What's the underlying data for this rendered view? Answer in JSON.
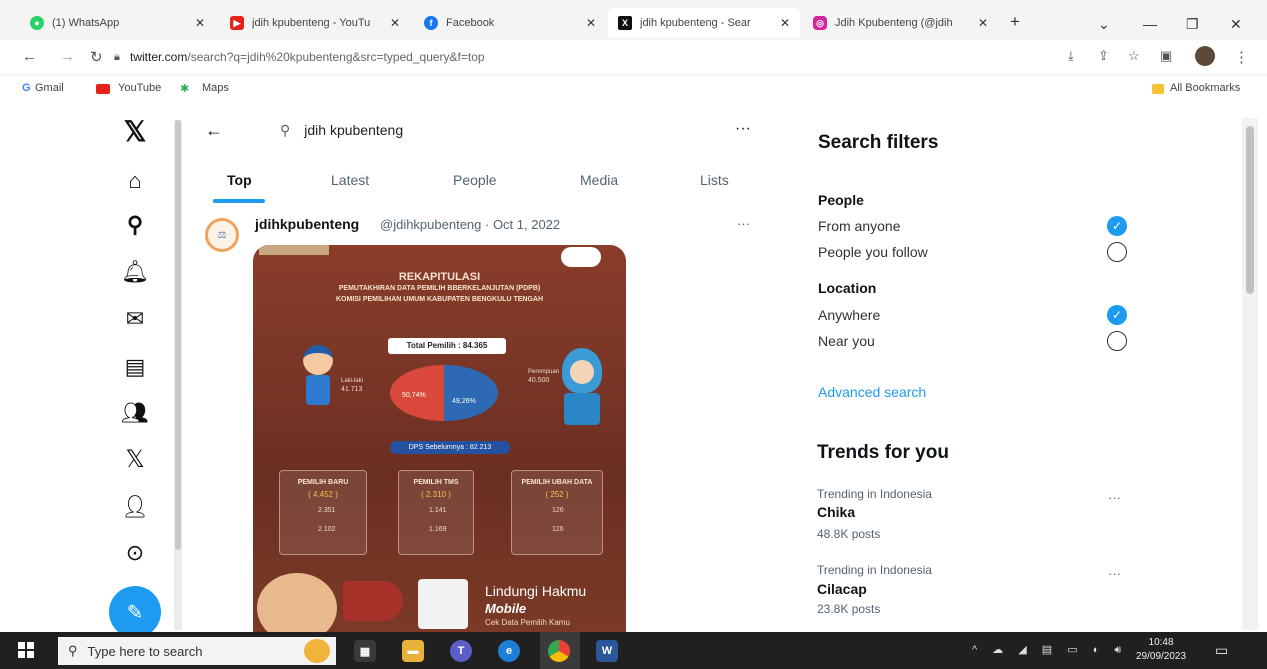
{
  "browser": {
    "tabs": [
      {
        "title": "(1) WhatsApp",
        "color": "#25d366",
        "glyph": "●"
      },
      {
        "title": "jdih kpubenteng - YouTu",
        "color": "#e62117",
        "glyph": "▶"
      },
      {
        "title": "Facebook",
        "color": "#1877f2",
        "glyph": "f"
      },
      {
        "title": "jdih kpubenteng - Sear",
        "color": "#111111",
        "glyph": "X"
      },
      {
        "title": "Jdih Kpubenteng (@jdih",
        "color": "#d6249f",
        "glyph": "◎"
      }
    ],
    "new_tab": "+",
    "url_domain": "twitter.com",
    "url_path": "/search?q=jdih%20kpubenteng&src=typed_query&f=top",
    "bookmarks": [
      "Gmail",
      "YouTube",
      "Maps"
    ],
    "all_bookmarks": "All Bookmarks"
  },
  "sidebar_icons": [
    "x-logo-icon",
    "home-icon",
    "explore-icon",
    "notifications-icon",
    "messages-icon",
    "lists-icon",
    "communities-icon",
    "premium-icon",
    "profile-icon",
    "more-icon"
  ],
  "search": {
    "query": "jdih kpubenteng",
    "more": "···"
  },
  "tabs": [
    "Top",
    "Latest",
    "People",
    "Media",
    "Lists"
  ],
  "post": {
    "name": "jdihkpubenteng",
    "meta": "@jdihkpubenteng · Oct 1, 2022",
    "more": "···",
    "image": {
      "title": "REKAPITULASI",
      "subtitle1": "PEMUTAKHIRAN DATA PEMILIH BBERKELANJUTAN (PDPB)",
      "subtitle2": "KOMISI PEMILIHAN UMUM KABUPATEN BENGKULU TENGAH",
      "total": "Total Pemilih : 84.365",
      "male_label": "Laki-laki",
      "male_count": "41.713",
      "female_label": "Perempuan",
      "female_count": "40.500",
      "male_pct": "50,74%",
      "female_pct": "49,26%",
      "dps": "DPS Sebelumnya : 82.213",
      "boxes": [
        {
          "title": "PEMILIH BARU",
          "count": "( 4.452 )",
          "a": "2.351",
          "b": "2.102"
        },
        {
          "title": "PEMILIH TMS",
          "count": "( 2.310 )",
          "a": "1.141",
          "b": "1.169"
        },
        {
          "title": "PEMILIH UBAH DATA",
          "count": "( 252 )",
          "a": "126",
          "b": "126"
        }
      ],
      "footer1": "Lindungi Hakmu",
      "footer2": "Mobile",
      "footer3": "Cek Data Pemilih Kamu"
    }
  },
  "filters": {
    "heading": "Search filters",
    "people_label": "People",
    "people_opts": [
      "From anyone",
      "People you follow"
    ],
    "people_selected": 0,
    "location_label": "Location",
    "location_opts": [
      "Anywhere",
      "Near you"
    ],
    "location_selected": 0,
    "advanced": "Advanced search"
  },
  "trends": {
    "heading": "Trends for you",
    "items": [
      {
        "context": "Trending in Indonesia",
        "name": "Chika",
        "posts": "48.8K posts"
      },
      {
        "context": "Trending in Indonesia",
        "name": "Cilacap",
        "posts": "23.8K posts"
      }
    ]
  },
  "taskbar": {
    "search_placeholder": "Type here to search",
    "time": "10:48",
    "date": "29/09/2023"
  }
}
